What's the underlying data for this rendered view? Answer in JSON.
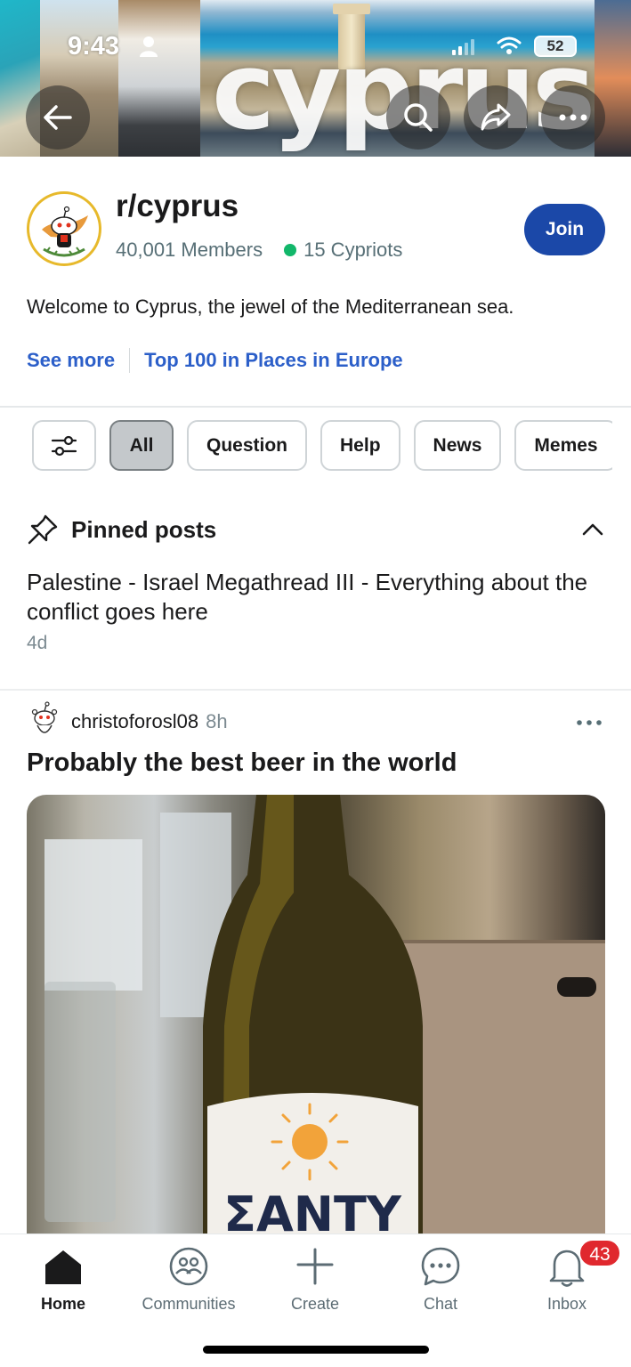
{
  "status_bar": {
    "time": "9:43",
    "battery": "52"
  },
  "banner": {
    "word": "cyprus"
  },
  "community": {
    "name": "r/cyprus",
    "members": "40,001 Members",
    "online": "15 Cypriots",
    "join_label": "Join",
    "description": "Welcome to Cyprus, the jewel of the Mediterranean sea.",
    "see_more": "See more",
    "ranking": "Top 100 in Places in Europe"
  },
  "filters": [
    {
      "label": "All",
      "active": true
    },
    {
      "label": "Question"
    },
    {
      "label": "Help"
    },
    {
      "label": "News"
    },
    {
      "label": "Memes"
    }
  ],
  "pinned": {
    "heading": "Pinned posts",
    "post_title": "Palestine - Israel Megathread III - Everything about the conflict goes here",
    "post_age": "4d"
  },
  "post": {
    "author": "christoforosl08",
    "age": "8h",
    "title": "Probably the best beer in the world",
    "image_label": "ΣΑΝΤΥ"
  },
  "nav": {
    "home": "Home",
    "communities": "Communities",
    "create": "Create",
    "chat": "Chat",
    "inbox": "Inbox",
    "inbox_badge": "43"
  },
  "colors": {
    "join_button": "#1b48a8",
    "link": "#2c5fc9",
    "online_dot": "#12b76a",
    "badge": "#e0282e"
  }
}
